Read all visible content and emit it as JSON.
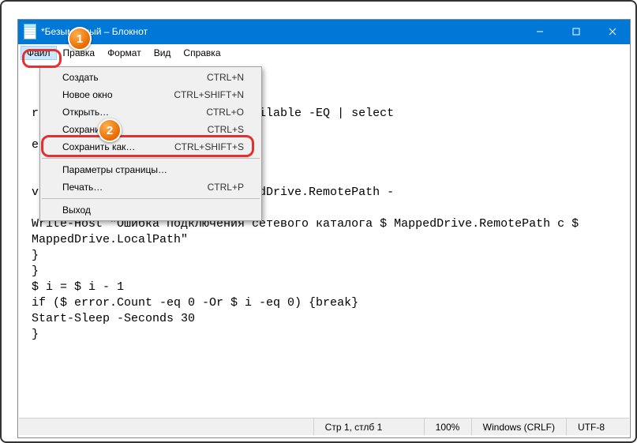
{
  "window": {
    "title": "*Безымянный – Блокнот"
  },
  "menubar": {
    "items": [
      "Файл",
      "Правка",
      "Формат",
      "Вид",
      "Справка"
    ]
  },
  "dropdown": {
    "create": {
      "label": "Создать",
      "shortcut": "CTRL+N"
    },
    "newwindow": {
      "label": "Новое окно",
      "shortcut": "CTRL+SHIFT+N"
    },
    "open": {
      "label": "Открыть…",
      "shortcut": "CTRL+O"
    },
    "save": {
      "label": "Сохранить",
      "shortcut": "CTRL+S"
    },
    "saveas": {
      "label": "Сохранить как…",
      "shortcut": "CTRL+SHIFT+S"
    },
    "pagesetup": {
      "label": "Параметры страницы…",
      "shortcut": ""
    },
    "print": {
      "label": "Печать…",
      "shortcut": "CTRL+P"
    },
    "exit": {
      "label": "Выход",
      "shortcut": ""
    }
  },
  "badges": {
    "one": "1",
    "two": "2"
  },
  "editor_text": "re -property Status -Value Unavailable -EQ | select\n\nes)\n\n\nve.LocalPath -RemotePath $ MappedDrive.RemotePath -\n\nWrite-Host \"Ошибка подключения сетевого каталога $ MappedDrive.RemotePath с $\nMappedDrive.LocalPath\"\n}\n}\n$ i = $ i - 1\nif ($ error.Count -eq 0 -Or $ i -eq 0) {break}\nStart-Sleep -Seconds 30\n}",
  "statusbar": {
    "pos": "Стр 1, стлб 1",
    "zoom": "100%",
    "eol": "Windows (CRLF)",
    "enc": "UTF-8"
  }
}
